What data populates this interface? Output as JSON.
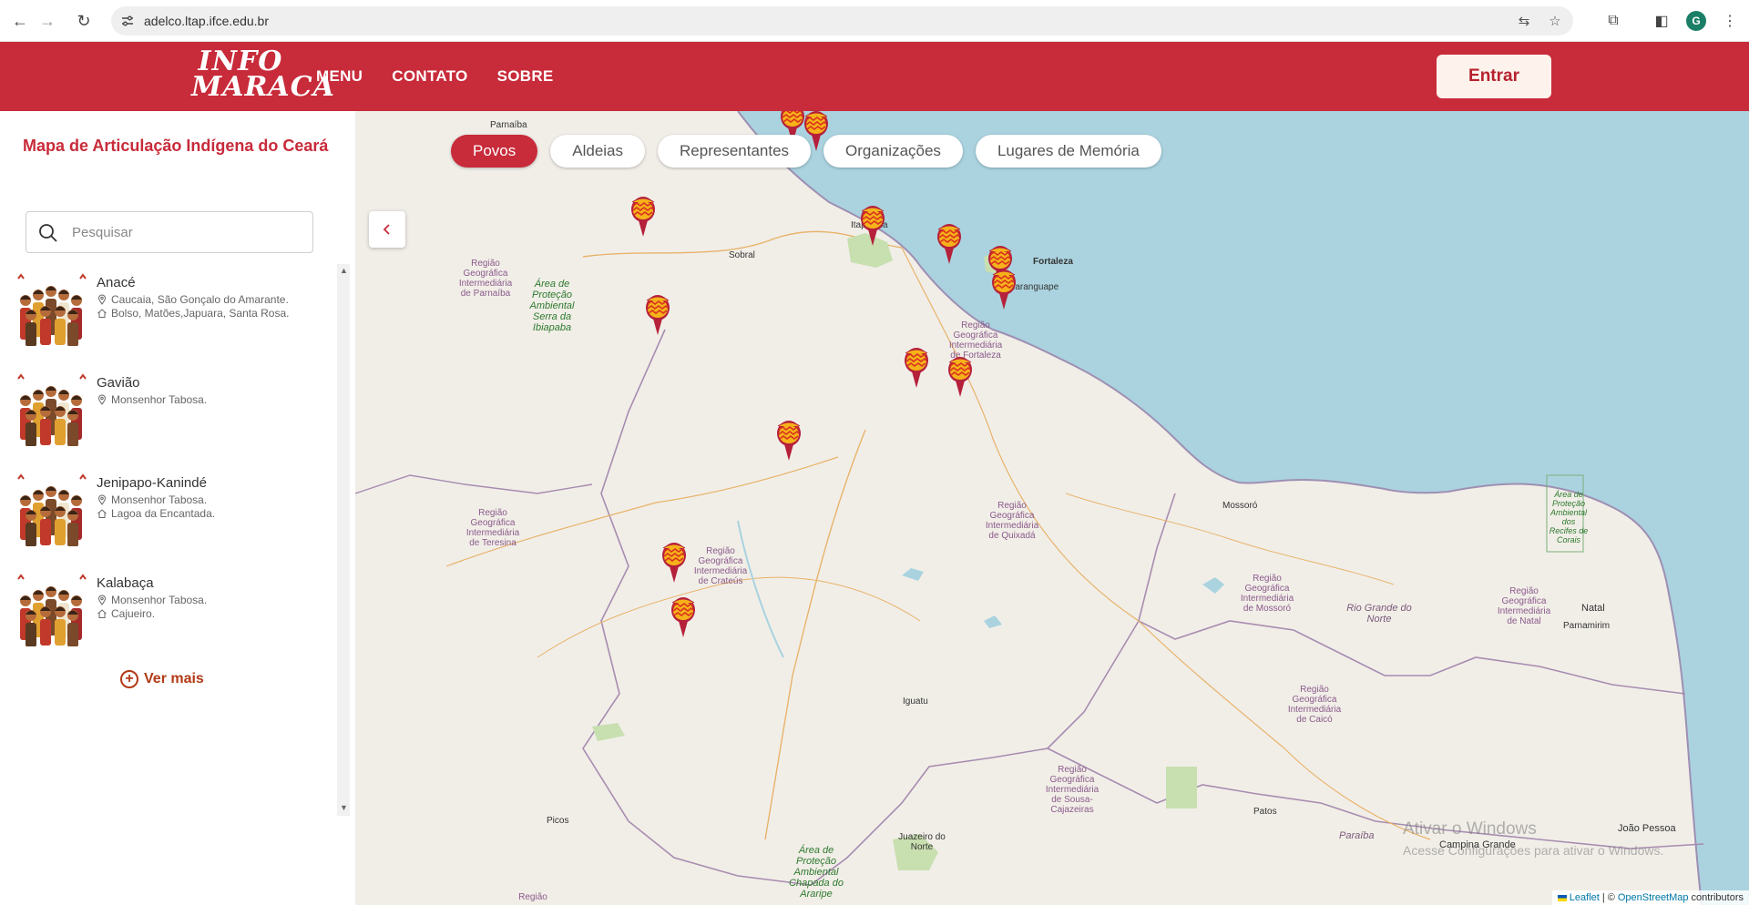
{
  "browser": {
    "url": "adelco.ltap.ifce.edu.br",
    "profile_initial": "G"
  },
  "header": {
    "logo_line1": "INFO",
    "logo_line2": "MARACA",
    "nav": [
      "MENU",
      "CONTATO",
      "SOBRE"
    ],
    "enter_label": "Entrar",
    "brand_color": "#c82b3a"
  },
  "sidebar": {
    "title": "Mapa de Articulação Indígena do Ceará",
    "search_placeholder": "Pesquisar",
    "items": [
      {
        "name": "Anacé",
        "location": "Caucaia, São Gonçalo do Amarante.",
        "villages": "Bolso, Matões,Japuara, Santa Rosa."
      },
      {
        "name": "Gavião",
        "location": "Monsenhor Tabosa.",
        "villages": ""
      },
      {
        "name": "Jenipapo-Kanindé",
        "location": "Monsenhor Tabosa.",
        "villages": "Lagoa da Encantada."
      },
      {
        "name": "Kalabaça",
        "location": "Monsenhor Tabosa.",
        "villages": "Cajueiro."
      }
    ],
    "more_label": "Ver mais"
  },
  "map": {
    "tabs": [
      {
        "label": "Povos",
        "active": true
      },
      {
        "label": "Aldeias",
        "active": false
      },
      {
        "label": "Representantes",
        "active": false
      },
      {
        "label": "Organizações",
        "active": false
      },
      {
        "label": "Lugares de Memória",
        "active": false
      }
    ],
    "places": [
      "Parnaíba",
      "Sobral",
      "Itapipoca",
      "Fortaleza",
      "Maranguape",
      "Mossoró",
      "Natal",
      "Parnamirim",
      "Iguatu",
      "Picos",
      "Juazeiro do Norte",
      "Patos",
      "Campina Grande",
      "João Pessoa",
      "Rio Grande do Norte",
      "Paraíba"
    ],
    "regions": [
      "Região Geográfica Intermediária de Parnaíba",
      "Região Geográfica Intermediária de Fortaleza",
      "Região Geográfica Intermediária de Teresina",
      "Região Geográfica Intermediária de Crateús",
      "Região Geográfica Intermediária de Quixadá",
      "Região Geográfica Intermediária de Mossoró",
      "Região Geográfica Intermediária de Natal",
      "Região Geográfica Intermediária de Caicó",
      "Região Geográfica Intermediária de Sousa-Cajazeiras",
      "Região"
    ],
    "protected_areas": [
      "Área de Proteção Ambiental Serra da Ibiapaba",
      "Área de Proteção Ambiental Chapada do Araripe",
      "Área de Proteção Ambiental dos Recifes de Corais"
    ],
    "attribution_leaflet": "Leaflet",
    "attribution_osm": "OpenStreetMap",
    "attribution_suffix": "contributors",
    "watermark_line1": "Ativar o Windows",
    "watermark_line2": "Acesse Configurações para ativar o Windows.",
    "colors": {
      "land": "#f1eee8",
      "sea": "#aad3df",
      "marker": "#b5203a"
    }
  }
}
